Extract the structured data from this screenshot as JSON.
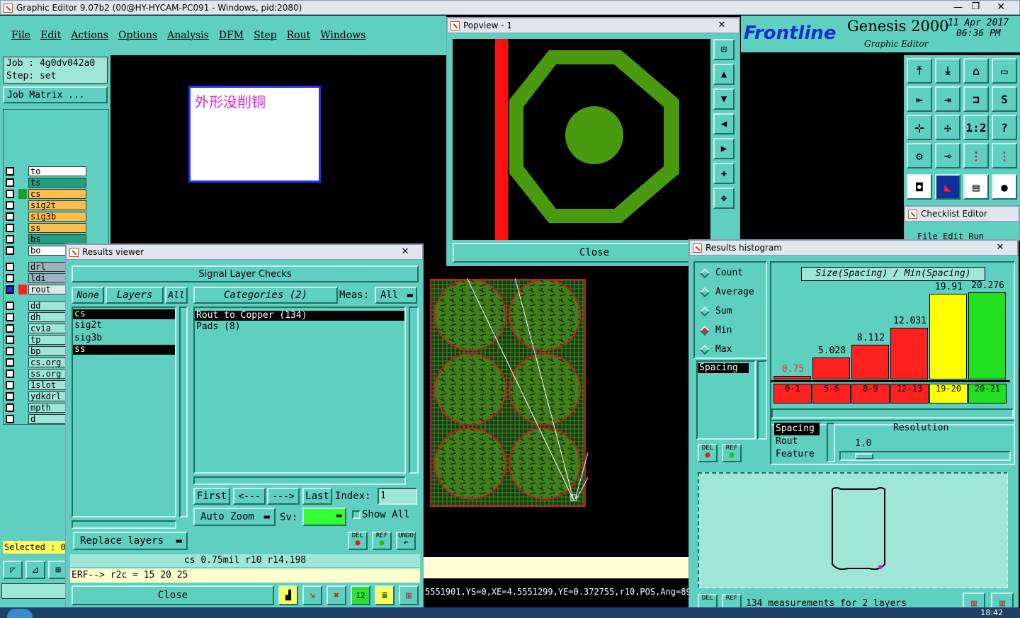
{
  "window_title": "Graphic Editor 9.07b2 (00@HY-HYCAM-PC091 - Windows, pid:2080)",
  "menu": [
    "File",
    "Edit",
    "Actions",
    "Options",
    "Analysis",
    "DFM",
    "Step",
    "Rout",
    "Windows"
  ],
  "job": {
    "job_label": "Job : 4g0dv042a0",
    "step_label": "Step: set",
    "matrix_button": "Job Matrix ..."
  },
  "layers": [
    {
      "name": "to",
      "color": "#ffffff"
    },
    {
      "name": "ts",
      "color": "#20a080"
    },
    {
      "name": "cs",
      "color": "#ffbf4f"
    },
    {
      "name": "sig2t",
      "color": "#ffbf4f"
    },
    {
      "name": "sig3b",
      "color": "#ffbf4f"
    },
    {
      "name": "ss",
      "color": "#ffbf4f"
    },
    {
      "name": "bs",
      "color": "#20a080"
    },
    {
      "name": "bo",
      "color": "#ffffff"
    },
    {
      "name": "drl",
      "color": "#9fb0bf"
    },
    {
      "name": "ldi",
      "color": "#9fb0bf"
    },
    {
      "name": "rout",
      "color": "#dfe6ee"
    },
    {
      "name": "dd",
      "color": "#9fe5d8"
    },
    {
      "name": "dh",
      "color": "#9fe5d8"
    },
    {
      "name": "cvia",
      "color": "#9fe5d8"
    },
    {
      "name": "tp",
      "color": "#9fe5d8"
    },
    {
      "name": "bp",
      "color": "#9fe5d8"
    },
    {
      "name": "cs.org",
      "color": "#9fe5d8"
    },
    {
      "name": "ss.org",
      "color": "#9fe5d8"
    },
    {
      "name": "1slot",
      "color": "#9fe5d8"
    },
    {
      "name": "ydkdrl",
      "color": "#9fe5d8"
    },
    {
      "name": "mpth",
      "color": "#9fe5d8"
    },
    {
      "name": "d",
      "color": "#9fe5d8"
    }
  ],
  "selected_label": "Selected : 0",
  "note_text": "外形没削铜",
  "brand": {
    "logo": "Frontline",
    "product": "Genesis 2000",
    "subtitle": "Graphic Editor",
    "date": "11 Apr 2017",
    "time": "06:36 PM"
  },
  "popview": {
    "title": "Popview - 1",
    "close_label": "Close"
  },
  "results_viewer": {
    "title": "Results viewer",
    "header": "Signal Layer Checks",
    "none_label": "None",
    "layers_label": "Layers",
    "all_label": "All",
    "categories_label": "Categories (2)",
    "meas_label": "Meas:",
    "meas_value": "All",
    "layer_list": [
      "cs",
      "sig2t",
      "sig3b",
      "ss"
    ],
    "categories": [
      "Rout to Copper (134)",
      "Pads (8)"
    ],
    "first_label": "First",
    "prev_label": "<---",
    "next_label": "--->",
    "last_label": "Last",
    "index_label": "Index:",
    "index_value": "1",
    "auto_zoom_label": "Auto Zoom",
    "sv_label": "Sv:",
    "show_all_label": "Show All",
    "replace_layers_label": "Replace layers",
    "del_label": "DEL",
    "ref_label": "REF",
    "undo_label": "UNDO",
    "status_line": "cs 0.75mil  r10  r14.198",
    "erf_line": "ERF--> r2c = 15 20 25",
    "close_label": "Close"
  },
  "coords_line": "5551901,YS=0,XE=4.5551299,YE=0.372755,r10,POS,Ang=89.",
  "checklist_title": "Checklist Editor",
  "checklist_menu": "File   Edit   Run",
  "histogram": {
    "title": "Results histogram",
    "modes": [
      "Count",
      "Average",
      "Sum",
      "Min",
      "Max"
    ],
    "selected_mode": "Min",
    "types": [
      "Spacing"
    ],
    "chart_title": "Size(Spacing) / Min(Spacing)",
    "res_list": [
      "Spacing",
      "Rout",
      "Feature"
    ],
    "resolution_label": "Resolution",
    "resolution_value": "1.0",
    "del_label": "DEL",
    "ref_label": "REF",
    "footer": "134 measurements for 2 layers"
  },
  "chart_data": {
    "type": "bar",
    "title": "Size(Spacing) / Min(Spacing)",
    "categories": [
      "0-1",
      "5-6",
      "8-9",
      "12-13",
      "19-20",
      "20-21"
    ],
    "values": [
      0.75,
      5.028,
      8.112,
      12.031,
      19.91,
      20.276
    ],
    "value_labels": [
      "0.75",
      "5.028",
      "8.112",
      "12.031",
      "19.91",
      "20.276"
    ],
    "colors": [
      "#ff2020",
      "#ff2020",
      "#ff2020",
      "#ff2020",
      "#ffff00",
      "#20e020"
    ],
    "ylim": [
      0,
      22
    ]
  },
  "taskbar": {
    "clock": "18:42"
  }
}
